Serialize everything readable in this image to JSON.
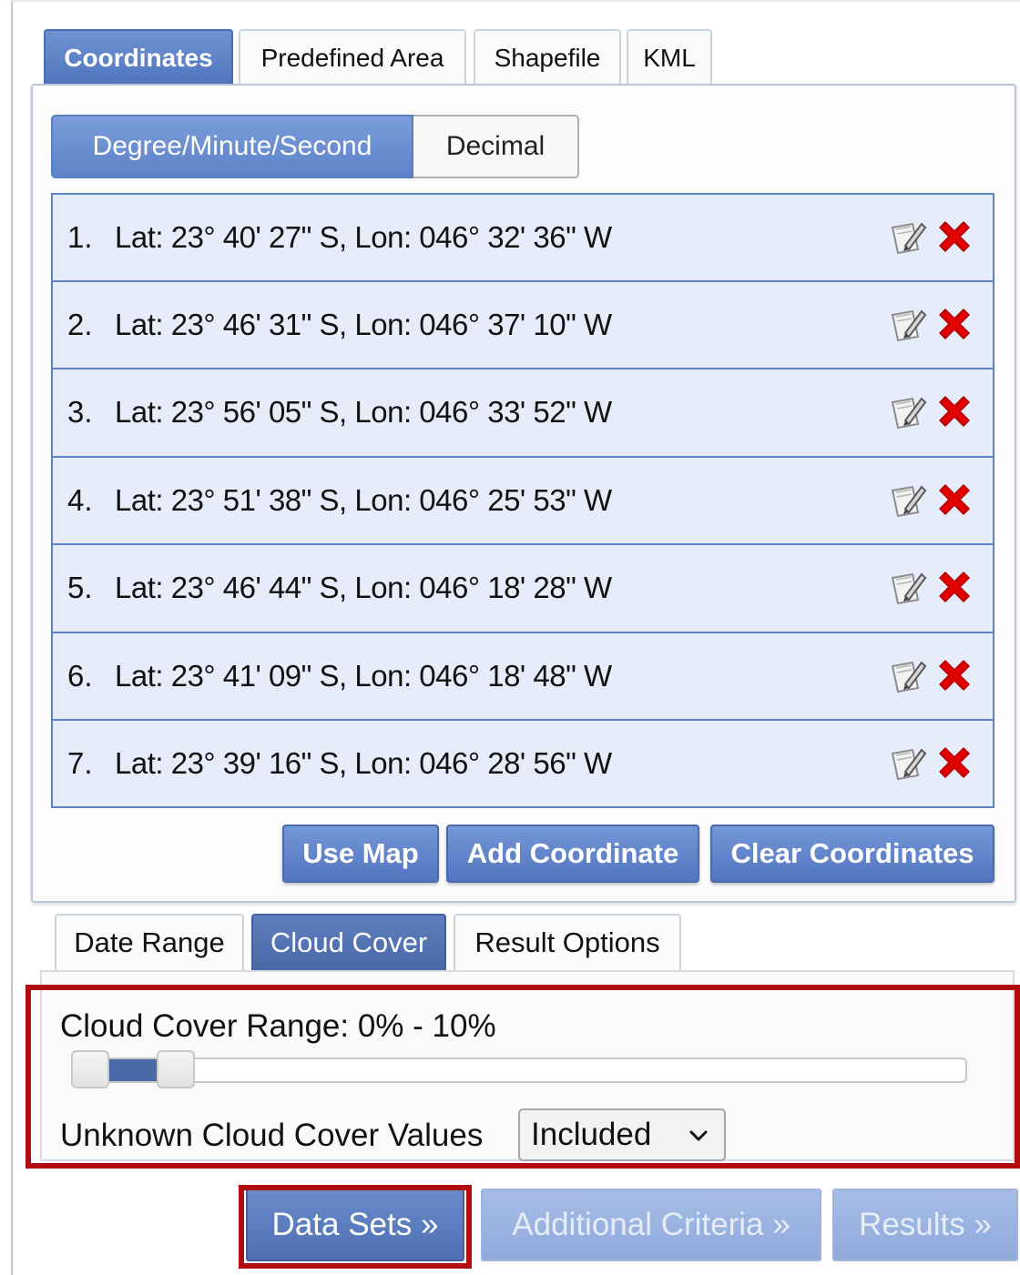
{
  "tabs_top": [
    {
      "label": "Coordinates",
      "active": true
    },
    {
      "label": "Predefined Area",
      "active": false
    },
    {
      "label": "Shapefile",
      "active": false
    },
    {
      "label": "KML",
      "active": false
    }
  ],
  "format_toggle": {
    "dms_label": "Degree/Minute/Second",
    "decimal_label": "Decimal",
    "selected": "Degree/Minute/Second"
  },
  "coordinates": [
    {
      "num": "1.",
      "text": "Lat: 23° 40' 27\" S, Lon: 046° 32' 36\" W"
    },
    {
      "num": "2.",
      "text": "Lat: 23° 46' 31\" S, Lon: 046° 37' 10\" W"
    },
    {
      "num": "3.",
      "text": "Lat: 23° 56' 05\" S, Lon: 046° 33' 52\" W"
    },
    {
      "num": "4.",
      "text": "Lat: 23° 51' 38\" S, Lon: 046° 25' 53\" W"
    },
    {
      "num": "5.",
      "text": "Lat: 23° 46' 44\" S, Lon: 046° 18' 28\" W"
    },
    {
      "num": "6.",
      "text": "Lat: 23° 41' 09\" S, Lon: 046° 18' 48\" W"
    },
    {
      "num": "7.",
      "text": "Lat: 23° 39' 16\" S, Lon: 046° 28' 56\" W"
    }
  ],
  "row_icons": {
    "edit": "edit-icon",
    "delete": "delete-icon"
  },
  "coord_actions": {
    "use_map": "Use Map",
    "add_coordinate": "Add Coordinate",
    "clear_coordinates": "Clear Coordinates"
  },
  "tabs_bottom": [
    {
      "label": "Date Range",
      "active": false
    },
    {
      "label": "Cloud Cover",
      "active": true
    },
    {
      "label": "Result Options",
      "active": false
    }
  ],
  "cloud_cover": {
    "range_label": "Cloud Cover Range: 0% - 10%",
    "min_percent": 0,
    "max_percent": 10,
    "unknown_label": "Unknown Cloud Cover Values",
    "unknown_value": "Included"
  },
  "nav": {
    "data_sets": "Data Sets »",
    "additional_criteria": "Additional Criteria »",
    "results": "Results »"
  },
  "colors": {
    "accent": "#5275bf",
    "row_bg": "#e6ecfa",
    "highlight": "#b10d10",
    "delete_red": "#e00000"
  }
}
